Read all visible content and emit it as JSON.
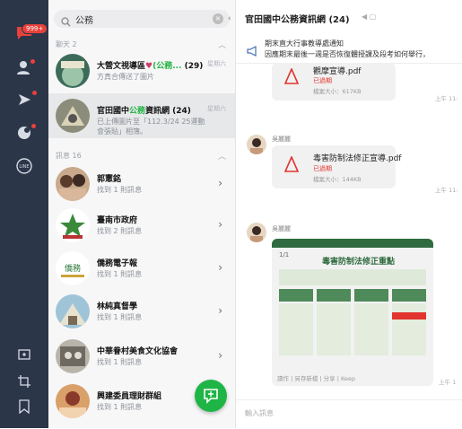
{
  "nav": {
    "chat_badge": "999+",
    "icons": [
      "chat-icon",
      "friends-icon",
      "timeline-icon",
      "today-icon",
      "line-icon",
      "add-window-icon",
      "crop-icon",
      "bookmark-icon"
    ]
  },
  "search": {
    "value": "公務"
  },
  "sections": {
    "chats": "聊天 2",
    "messages": "訊息 16"
  },
  "chats": [
    {
      "name_pre": "大營文視導區",
      "name_hl": "(公務...",
      "name_count": "(29)",
      "sub": "方真合傳送了圖片",
      "time": "星期六"
    },
    {
      "name_pre": "官田國中",
      "name_hl": "公務",
      "name_post": "資訊網 (24)",
      "sub1": "已上傳圖片至「112.3/24 25運動",
      "sub2": "會張貼」相簿。",
      "time": "星期六"
    }
  ],
  "messages": [
    {
      "name": "郭憲銘",
      "sub": "找到 1 則訊息"
    },
    {
      "name": "臺南市政府",
      "sub": "找到 2 則訊息"
    },
    {
      "name": "僑務電子報",
      "sub": "找到 1 則訊息"
    },
    {
      "name": "林純真督學",
      "sub": "找到 1 則訊息"
    },
    {
      "name": "中華眷村美食文化協會",
      "sub": "找到 1 則訊息"
    },
    {
      "name": "興建委員理財群組",
      "sub": "找到 1 則訊息"
    }
  ],
  "chat": {
    "title": "官田國中公務資訊網 (24)",
    "announce1": "期末直大行事教導處通知",
    "announce2": "因應期末最後一週是否恢復體授課及段考如何舉行，",
    "files": [
      {
        "name": "觀摩宣導.pdf",
        "status": "已過期",
        "size": "檔案大小：617KB",
        "time": "上午 11:"
      },
      {
        "sender": "吳麗麗",
        "name": "毒害防制法修正宣導.pdf",
        "status": "已過期",
        "size": "檔案大小：144KB",
        "time": "上午 11:"
      }
    ],
    "image_sender": "吳麗麗",
    "image_caption": "1/1",
    "image_title": "毒害防制法修正重點",
    "image_footer": "讀作 | 另存新檔 | 分享 | Keep",
    "image_time": "上午 1",
    "input_placeholder": "輸入訊息"
  },
  "colors": {
    "nav_bg": "#2b3649",
    "accent": "#1fb546",
    "badge": "#e8413c",
    "pdf": "#e2352f"
  }
}
